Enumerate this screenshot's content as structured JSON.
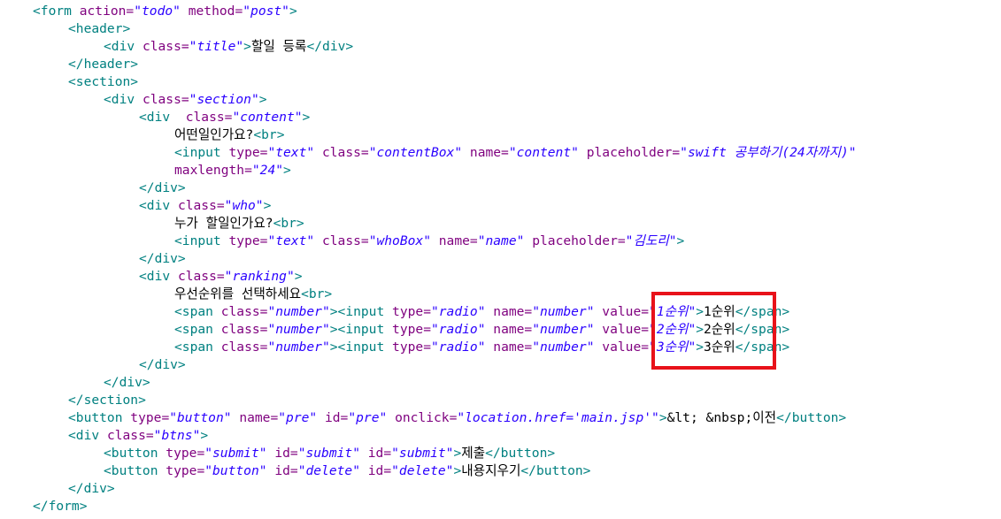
{
  "colors": {
    "tag": "#008080",
    "attr": "#7f007f",
    "value": "#2a00ff",
    "text": "#000000",
    "highlight": "#e8121a"
  },
  "lines": [
    {
      "indent": 0,
      "parts": [
        [
          "t",
          "<form "
        ],
        [
          "a",
          "action="
        ],
        [
          "v",
          "\"todo\""
        ],
        [
          "a",
          " method="
        ],
        [
          "v",
          "\"post\""
        ],
        [
          "t",
          ">"
        ]
      ]
    },
    {
      "indent": 1,
      "parts": [
        [
          "t",
          "<header>"
        ]
      ]
    },
    {
      "indent": 2,
      "parts": [
        [
          "t",
          "<div "
        ],
        [
          "a",
          "class="
        ],
        [
          "v",
          "\"title\""
        ],
        [
          "t",
          ">"
        ],
        [
          "tx",
          "할일 등록"
        ],
        [
          "t",
          "</div>"
        ]
      ]
    },
    {
      "indent": 1,
      "parts": [
        [
          "t",
          "</header>"
        ]
      ]
    },
    {
      "indent": 1,
      "parts": [
        [
          "t",
          "<section>"
        ]
      ]
    },
    {
      "indent": 2,
      "parts": [
        [
          "t",
          "<div "
        ],
        [
          "a",
          "class="
        ],
        [
          "v",
          "\"section\""
        ],
        [
          "t",
          ">"
        ]
      ]
    },
    {
      "indent": 3,
      "parts": [
        [
          "t",
          "<div  "
        ],
        [
          "a",
          "class="
        ],
        [
          "v",
          "\"content\""
        ],
        [
          "t",
          ">"
        ]
      ]
    },
    {
      "indent": 4,
      "parts": [
        [
          "tx",
          "어떤일인가요?"
        ],
        [
          "t",
          "<br>"
        ]
      ]
    },
    {
      "indent": 4,
      "parts": [
        [
          "t",
          "<input "
        ],
        [
          "a",
          "type="
        ],
        [
          "v",
          "\"text\""
        ],
        [
          "a",
          " class="
        ],
        [
          "v",
          "\"contentBox\""
        ],
        [
          "a",
          " name="
        ],
        [
          "v",
          "\"content\""
        ],
        [
          "a",
          " placeholder="
        ],
        [
          "v",
          "\"swift 공부하기(24자까지)\""
        ]
      ]
    },
    {
      "indent": 4,
      "parts": [
        [
          "a",
          "maxlength="
        ],
        [
          "v",
          "\"24\""
        ],
        [
          "t",
          ">"
        ]
      ]
    },
    {
      "indent": 3,
      "parts": [
        [
          "t",
          "</div>"
        ]
      ]
    },
    {
      "indent": 3,
      "parts": [
        [
          "t",
          "<div "
        ],
        [
          "a",
          "class="
        ],
        [
          "v",
          "\"who\""
        ],
        [
          "t",
          ">"
        ]
      ]
    },
    {
      "indent": 4,
      "parts": [
        [
          "tx",
          "누가 할일인가요?"
        ],
        [
          "t",
          "<br>"
        ]
      ]
    },
    {
      "indent": 4,
      "parts": [
        [
          "t",
          "<input "
        ],
        [
          "a",
          "type="
        ],
        [
          "v",
          "\"text\""
        ],
        [
          "a",
          " class="
        ],
        [
          "v",
          "\"whoBox\""
        ],
        [
          "a",
          " name="
        ],
        [
          "v",
          "\"name\""
        ],
        [
          "a",
          " placeholder="
        ],
        [
          "v",
          "\"김도리\""
        ],
        [
          "t",
          ">"
        ]
      ]
    },
    {
      "indent": 3,
      "parts": [
        [
          "t",
          "</div>"
        ]
      ]
    },
    {
      "indent": 3,
      "parts": [
        [
          "t",
          "<div "
        ],
        [
          "a",
          "class="
        ],
        [
          "v",
          "\"ranking\""
        ],
        [
          "t",
          ">"
        ]
      ]
    },
    {
      "indent": 4,
      "parts": [
        [
          "tx",
          "우선순위를 선택하세요"
        ],
        [
          "t",
          "<br>"
        ]
      ]
    },
    {
      "indent": 4,
      "parts": [
        [
          "t",
          "<span "
        ],
        [
          "a",
          "class="
        ],
        [
          "v",
          "\"number\""
        ],
        [
          "t",
          ">"
        ],
        [
          "t",
          "<input "
        ],
        [
          "a",
          "type="
        ],
        [
          "v",
          "\"radio\""
        ],
        [
          "a",
          " name="
        ],
        [
          "v",
          "\"number\""
        ],
        [
          "a",
          " value="
        ],
        [
          "v",
          "\"1순위\""
        ],
        [
          "t",
          ">"
        ],
        [
          "tx",
          "1순위"
        ],
        [
          "t",
          "</span>"
        ]
      ]
    },
    {
      "indent": 4,
      "parts": [
        [
          "t",
          "<span "
        ],
        [
          "a",
          "class="
        ],
        [
          "v",
          "\"number\""
        ],
        [
          "t",
          ">"
        ],
        [
          "t",
          "<input "
        ],
        [
          "a",
          "type="
        ],
        [
          "v",
          "\"radio\""
        ],
        [
          "a",
          " name="
        ],
        [
          "v",
          "\"number\""
        ],
        [
          "a",
          " value="
        ],
        [
          "v",
          "\"2순위\""
        ],
        [
          "t",
          ">"
        ],
        [
          "tx",
          "2순위"
        ],
        [
          "t",
          "</span>"
        ]
      ]
    },
    {
      "indent": 4,
      "parts": [
        [
          "t",
          "<span "
        ],
        [
          "a",
          "class="
        ],
        [
          "v",
          "\"number\""
        ],
        [
          "t",
          ">"
        ],
        [
          "t",
          "<input "
        ],
        [
          "a",
          "type="
        ],
        [
          "v",
          "\"radio\""
        ],
        [
          "a",
          " name="
        ],
        [
          "v",
          "\"number\""
        ],
        [
          "a",
          " value="
        ],
        [
          "v",
          "\"3순위\""
        ],
        [
          "t",
          ">"
        ],
        [
          "tx",
          "3순위"
        ],
        [
          "t",
          "</span>"
        ]
      ]
    },
    {
      "indent": 3,
      "parts": [
        [
          "t",
          "</div>"
        ]
      ]
    },
    {
      "indent": 2,
      "parts": [
        [
          "t",
          "</div>"
        ]
      ]
    },
    {
      "indent": 1,
      "parts": [
        [
          "t",
          "</section>"
        ]
      ]
    },
    {
      "indent": 1,
      "parts": [
        [
          "t",
          "<button "
        ],
        [
          "a",
          "type="
        ],
        [
          "v",
          "\"button\""
        ],
        [
          "a",
          " name="
        ],
        [
          "v",
          "\"pre\""
        ],
        [
          "a",
          " id="
        ],
        [
          "v",
          "\"pre\""
        ],
        [
          "a",
          " onclick="
        ],
        [
          "v",
          "\"location.href='main.jsp'\""
        ],
        [
          "t",
          ">"
        ],
        [
          "tx",
          "&lt; &nbsp;이전"
        ],
        [
          "t",
          "</button>"
        ]
      ]
    },
    {
      "indent": 1,
      "parts": [
        [
          "t",
          "<div "
        ],
        [
          "a",
          "class="
        ],
        [
          "v",
          "\"btns\""
        ],
        [
          "t",
          ">"
        ]
      ]
    },
    {
      "indent": 2,
      "parts": [
        [
          "t",
          "<button "
        ],
        [
          "a",
          "type="
        ],
        [
          "v",
          "\"submit\""
        ],
        [
          "a",
          " id="
        ],
        [
          "v",
          "\"submit\""
        ],
        [
          "a",
          " id="
        ],
        [
          "v",
          "\"submit\""
        ],
        [
          "t",
          ">"
        ],
        [
          "tx",
          "제출"
        ],
        [
          "t",
          "</button>"
        ]
      ]
    },
    {
      "indent": 2,
      "parts": [
        [
          "t",
          "<button "
        ],
        [
          "a",
          "type="
        ],
        [
          "v",
          "\"button\""
        ],
        [
          "a",
          " id="
        ],
        [
          "v",
          "\"delete\""
        ],
        [
          "a",
          " id="
        ],
        [
          "v",
          "\"delete\""
        ],
        [
          "t",
          ">"
        ],
        [
          "tx",
          "내용지우기"
        ],
        [
          "t",
          "</button>"
        ]
      ]
    },
    {
      "indent": 1,
      "parts": [
        [
          "t",
          "</div>"
        ]
      ]
    },
    {
      "indent": 0,
      "parts": [
        [
          "t",
          "</form>"
        ]
      ]
    }
  ]
}
